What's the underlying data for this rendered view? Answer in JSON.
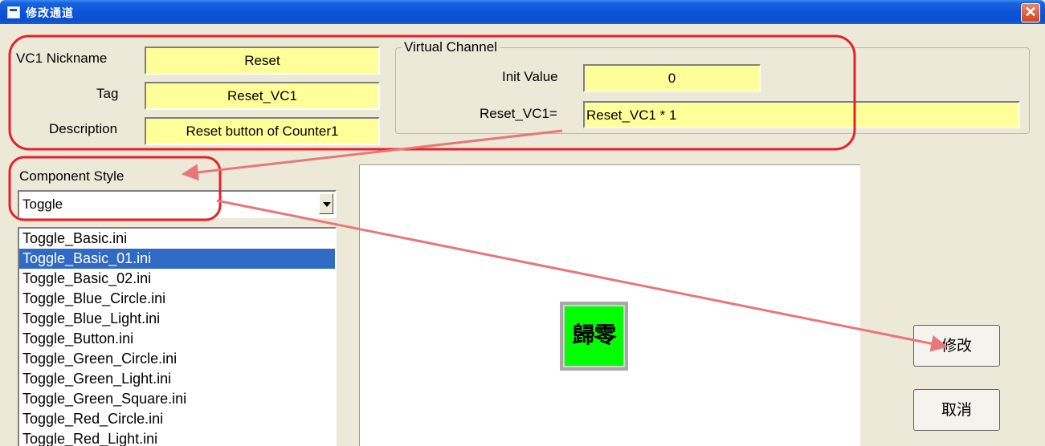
{
  "window": {
    "title": "修改通道",
    "close_glyph": "✕"
  },
  "fields": {
    "nickname_label": "VC1 Nickname",
    "nickname_value": "Reset",
    "tag_label": "Tag",
    "tag_value": "Reset_VC1",
    "description_label": "Description",
    "description_value": "Reset button of Counter1"
  },
  "virtual_channel": {
    "group_title": "Virtual Channel",
    "init_label": "Init Value",
    "init_value": "0",
    "formula_label": "Reset_VC1=",
    "formula_value": "Reset_VC1 * 1"
  },
  "component": {
    "style_label": "Component Style",
    "style_value": "Toggle",
    "files": [
      "Toggle_Basic.ini",
      "Toggle_Basic_01.ini",
      "Toggle_Basic_02.ini",
      "Toggle_Blue_Circle.ini",
      "Toggle_Blue_Light.ini",
      "Toggle_Button.ini",
      "Toggle_Green_Circle.ini",
      "Toggle_Green_Light.ini",
      "Toggle_Green_Square.ini",
      "Toggle_Red_Circle.ini",
      "Toggle_Red_Light.ini"
    ],
    "selected_index": 1
  },
  "preview": {
    "button_text": "歸零",
    "button_color": "#00ff00"
  },
  "buttons": {
    "ok": "修改",
    "cancel": "取消"
  },
  "colors": {
    "highlight": "#e8202a",
    "arrow": "#e8767a",
    "field_bg": "#ffff99",
    "selection": "#316ac5"
  }
}
